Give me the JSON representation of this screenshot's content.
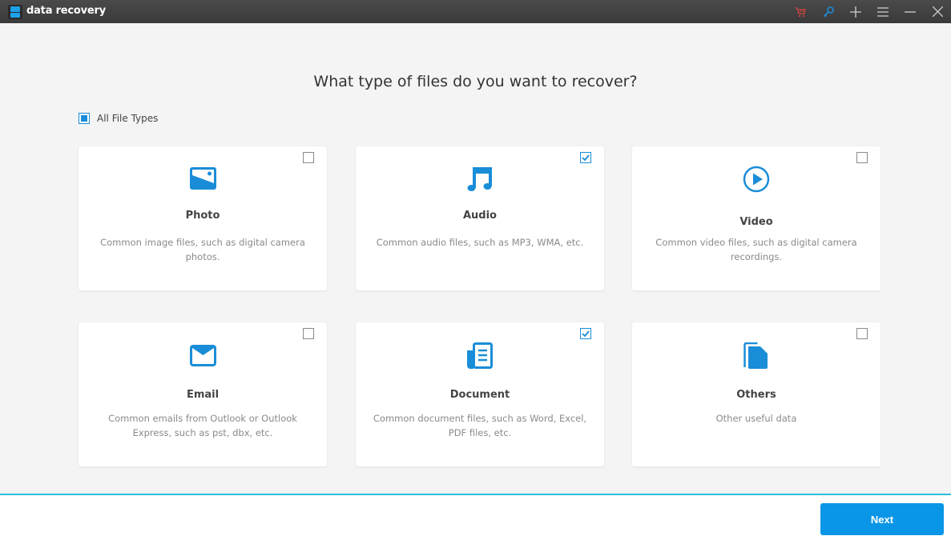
{
  "app": {
    "title": "data recovery"
  },
  "titlebar": {
    "icons": [
      {
        "name": "cart-icon",
        "color": "#d9463d"
      },
      {
        "name": "key-icon",
        "color": "#1a8dd8"
      },
      {
        "name": "plus-icon",
        "color": "#d0d0d0"
      },
      {
        "name": "menu-icon",
        "color": "#d0d0d0"
      },
      {
        "name": "minimize-icon",
        "color": "#d0d0d0"
      },
      {
        "name": "close-icon",
        "color": "#d0d0d0"
      }
    ]
  },
  "main": {
    "heading": "What type of files do you want to recover?",
    "all_file_types": {
      "label": "All File Types",
      "state": "partial"
    },
    "cards": [
      {
        "key": "photo",
        "title": "Photo",
        "description": "Common image files, such as digital camera photos.",
        "checked": false
      },
      {
        "key": "audio",
        "title": "Audio",
        "description": "Common audio files, such as MP3, WMA, etc.",
        "checked": true
      },
      {
        "key": "video",
        "title": "Video",
        "description": "Common video files, such as digital camera recordings.",
        "checked": false
      },
      {
        "key": "email",
        "title": "Email",
        "description": "Common emails from Outlook or Outlook Express, such as pst, dbx, etc.",
        "checked": false
      },
      {
        "key": "document",
        "title": "Document",
        "description": "Common document files, such as Word, Excel, PDF files, etc.",
        "checked": true
      },
      {
        "key": "others",
        "title": "Others",
        "description": "Other useful data",
        "checked": false
      }
    ]
  },
  "footer": {
    "next_label": "Next"
  },
  "colors": {
    "accent": "#0a96e6",
    "icon_blue": "#1a8dd8",
    "footer_line": "#2bbfd9",
    "titlebar": "#404040"
  }
}
